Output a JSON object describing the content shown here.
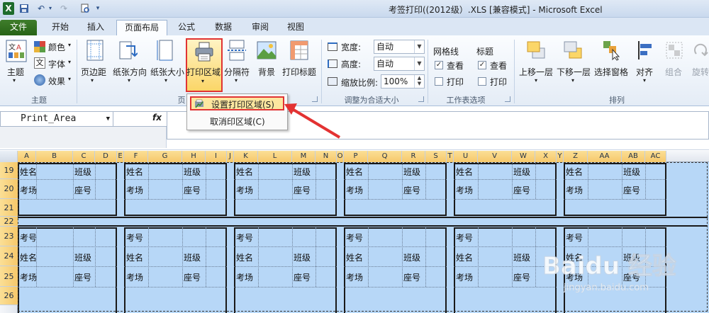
{
  "window": {
    "title": "考签打印((2012级）.XLS  [兼容模式] - Microsoft Excel"
  },
  "quick_access": [
    "save-icon",
    "undo-icon",
    "redo-icon",
    "print-preview-icon"
  ],
  "tabs": [
    "文件",
    "开始",
    "插入",
    "页面布局",
    "公式",
    "数据",
    "审阅",
    "视图"
  ],
  "active_tab": "页面布局",
  "ribbon": {
    "theme_group": {
      "label": "主题",
      "themes": "主题",
      "colors": "颜色",
      "fonts": "字体",
      "effects": "效果"
    },
    "page_setup_group": {
      "label": "页",
      "margins": "页边距",
      "orientation": "纸张方向",
      "size": "纸张大小",
      "print_area": "打印区域",
      "breaks": "分隔符",
      "background": "背景",
      "print_titles": "打印标题"
    },
    "scale_group": {
      "label": "调整为合适大小",
      "width_label": "宽度:",
      "width_value": "自动",
      "height_label": "高度:",
      "height_value": "自动",
      "scale_label": "缩放比例:",
      "scale_value": "100%"
    },
    "sheet_options_group": {
      "label": "工作表选项",
      "gridlines": "网格线",
      "headings": "标题",
      "view": "查看",
      "print": "打印"
    },
    "arrange_group": {
      "label": "排列",
      "bring_forward": "上移一层",
      "send_backward": "下移一层",
      "selection_pane": "选择窗格",
      "align": "对齐",
      "group": "组合",
      "rotate": "旋转"
    }
  },
  "print_area_menu": {
    "set": "设置打印区域(S)",
    "clear": "取消印区域(C)"
  },
  "name_box": "Print_Area",
  "fx": "fx",
  "columns": [
    "A",
    "B",
    "C",
    "D",
    "E",
    "F",
    "G",
    "H",
    "I",
    "J",
    "K",
    "L",
    "M",
    "N",
    "O",
    "P",
    "Q",
    "R",
    "S",
    "T",
    "U",
    "V",
    "W",
    "X",
    "Y",
    "Z",
    "AA",
    "AB",
    "AC"
  ],
  "rows": [
    "19",
    "20",
    "21",
    "22",
    "23",
    "24",
    "25",
    "26"
  ],
  "labels": {
    "name": "姓名",
    "class": "班级",
    "room": "考场",
    "seat": "座号",
    "exam_no": "考号"
  },
  "watermark": {
    "brand": "Baidu 经验",
    "url": "jingyan.baidu.com"
  },
  "colors": {
    "selection": "#b7d7f7",
    "file_tab": "#2f7020",
    "highlight_border": "#e03434",
    "header_selected": "#f6c86a"
  }
}
